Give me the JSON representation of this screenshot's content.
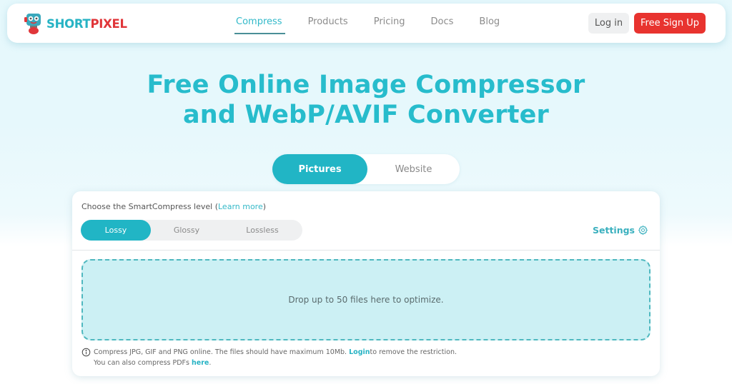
{
  "brand": {
    "name_part1": "SHORT",
    "name_part2": "PIXEL",
    "colors": {
      "teal": "#27b3c4",
      "red": "#e0363a"
    }
  },
  "nav": {
    "links": [
      {
        "label": "Compress",
        "active": true
      },
      {
        "label": "Products",
        "active": false
      },
      {
        "label": "Pricing",
        "active": false
      },
      {
        "label": "Docs",
        "active": false
      },
      {
        "label": "Blog",
        "active": false
      }
    ],
    "login_label": "Log in",
    "signup_label": "Free Sign Up"
  },
  "hero": {
    "title_line1": "Free Online Image Compressor",
    "title_line2": "and WebP/AVIF Converter"
  },
  "mode_toggle": {
    "options": [
      "Pictures",
      "Website"
    ],
    "selected": "Pictures"
  },
  "compressor": {
    "level_label": "Choose the SmartCompress level (",
    "learn_more": "Learn more",
    "level_label_end": ")",
    "levels": [
      "Lossy",
      "Glossy",
      "Lossless"
    ],
    "selected_level": "Lossy",
    "settings_label": "Settings",
    "dropzone_text": "Drop up to 50 files here to optimize.",
    "info_line1_a": "Compress JPG, GIF and PNG online. The files should have maximum 10Mb. ",
    "info_login": "Login",
    "info_line1_b": " to remove the restriction.",
    "info_line2_a": "You can also compress PDFs ",
    "info_here": "here",
    "info_line2_b": "."
  }
}
